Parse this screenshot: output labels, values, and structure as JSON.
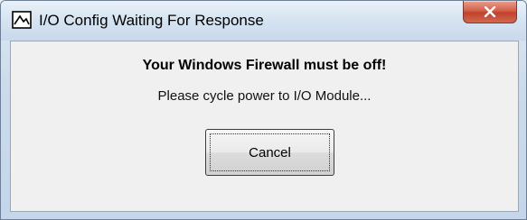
{
  "window": {
    "title": "I/O Config Waiting For Response",
    "close_glyph": "X",
    "title_icon": "app-icon"
  },
  "dialog": {
    "warning": "Your Windows Firewall must be off!",
    "message": "Please cycle power to I/O Module...",
    "cancel_label": "Cancel"
  }
}
